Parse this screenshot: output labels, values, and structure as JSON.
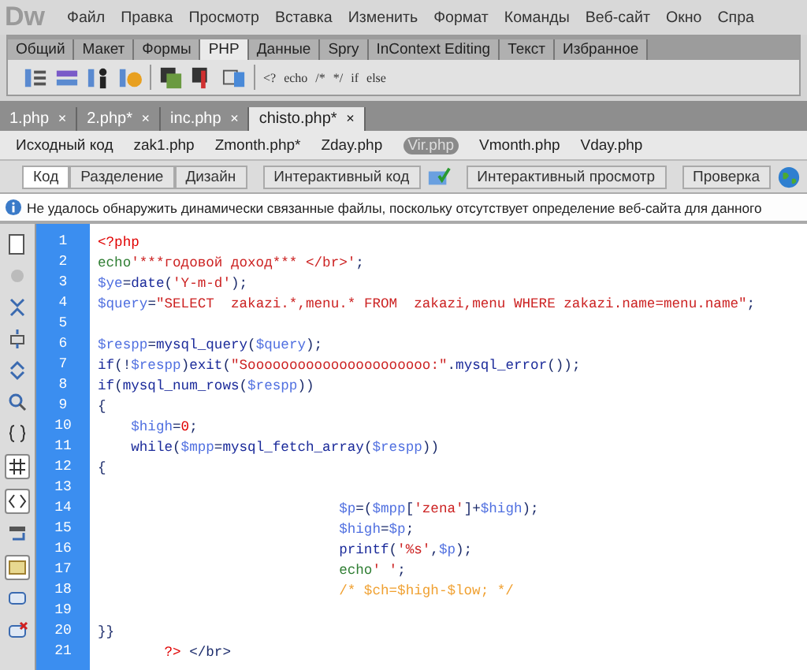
{
  "app_logo": "Dw",
  "menu": [
    "Файл",
    "Правка",
    "Просмотр",
    "Вставка",
    "Изменить",
    "Формат",
    "Команды",
    "Веб-сайт",
    "Окно",
    "Спра"
  ],
  "insert_tabs": [
    {
      "label": "Общий",
      "selected": false
    },
    {
      "label": "Макет",
      "selected": false
    },
    {
      "label": "Формы",
      "selected": false
    },
    {
      "label": "PHP",
      "selected": true
    },
    {
      "label": "Данные",
      "selected": false
    },
    {
      "label": "Spry",
      "selected": false
    },
    {
      "label": "InContext Editing",
      "selected": false
    },
    {
      "label": "Текст",
      "selected": false
    },
    {
      "label": "Избранное",
      "selected": false
    }
  ],
  "insert_text_buttons": [
    "<?",
    "echo",
    "/*",
    "*/",
    "if",
    "else"
  ],
  "doc_tabs": [
    {
      "label": "1.php",
      "selected": false
    },
    {
      "label": "2.php*",
      "selected": false
    },
    {
      "label": "inc.php",
      "selected": false
    },
    {
      "label": "chisto.php*",
      "selected": true
    }
  ],
  "close_glyph": "×",
  "related_files": [
    {
      "label": "Исходный код",
      "selected": false
    },
    {
      "label": "zak1.php",
      "selected": false
    },
    {
      "label": "Zmonth.php*",
      "selected": false
    },
    {
      "label": "Zday.php",
      "selected": false
    },
    {
      "label": "Vir.php",
      "selected": true
    },
    {
      "label": "Vmonth.php",
      "selected": false
    },
    {
      "label": "Vday.php",
      "selected": false
    }
  ],
  "view_modes": [
    {
      "label": "Код",
      "selected": true
    },
    {
      "label": "Разделение",
      "selected": false
    },
    {
      "label": "Дизайн",
      "selected": false
    }
  ],
  "live_code_button": "Интерактивный код",
  "live_view_button": "Интерактивный просмотр",
  "check_button": "Проверка",
  "info_message": "Не удалось обнаружить динамически связанные файлы, поскольку отсутствует определение веб-сайта для данного",
  "code_lines": [
    {
      "number": "1",
      "tokens": [
        {
          "kind": "tag",
          "text": "<?php"
        }
      ]
    },
    {
      "number": "2",
      "tokens": [
        {
          "kind": "keyword",
          "text": "echo"
        },
        {
          "kind": "string",
          "text": "'***годовой доход*** </br>'"
        },
        {
          "kind": "punct",
          "text": ";"
        }
      ]
    },
    {
      "number": "3",
      "tokens": [
        {
          "kind": "var",
          "text": "$ye"
        },
        {
          "kind": "punct",
          "text": "="
        },
        {
          "kind": "func",
          "text": "date"
        },
        {
          "kind": "punct",
          "text": "("
        },
        {
          "kind": "string",
          "text": "'Y-m-d'"
        },
        {
          "kind": "punct",
          "text": ");"
        }
      ]
    },
    {
      "number": "4",
      "tokens": [
        {
          "kind": "var",
          "text": "$query"
        },
        {
          "kind": "punct",
          "text": "="
        },
        {
          "kind": "string",
          "text": "\"SELECT  zakazi.*,menu.* FROM  zakazi,menu WHERE zakazi.name=menu.name\""
        },
        {
          "kind": "punct",
          "text": ";"
        }
      ]
    },
    {
      "number": "5"
    },
    {
      "number": "6",
      "tokens": [
        {
          "kind": "var",
          "text": "$respp"
        },
        {
          "kind": "punct",
          "text": "="
        },
        {
          "kind": "func",
          "text": "mysql_query"
        },
        {
          "kind": "punct",
          "text": "("
        },
        {
          "kind": "var",
          "text": "$query"
        },
        {
          "kind": "punct",
          "text": ");"
        }
      ]
    },
    {
      "number": "7",
      "tokens": [
        {
          "kind": "func",
          "text": "if"
        },
        {
          "kind": "punct",
          "text": "(!"
        },
        {
          "kind": "var",
          "text": "$respp"
        },
        {
          "kind": "punct",
          "text": ")"
        },
        {
          "kind": "func",
          "text": "exit"
        },
        {
          "kind": "punct",
          "text": "("
        },
        {
          "kind": "string",
          "text": "\"Soooooooooooooooooooooo:\""
        },
        {
          "kind": "punct",
          "text": "."
        },
        {
          "kind": "func",
          "text": "mysql_error"
        },
        {
          "kind": "punct",
          "text": "());"
        }
      ]
    },
    {
      "number": "8",
      "tokens": [
        {
          "kind": "func",
          "text": "if"
        },
        {
          "kind": "punct",
          "text": "("
        },
        {
          "kind": "func",
          "text": "mysql_num_rows"
        },
        {
          "kind": "punct",
          "text": "("
        },
        {
          "kind": "var",
          "text": "$respp"
        },
        {
          "kind": "punct",
          "text": "))"
        }
      ]
    },
    {
      "number": "9",
      "tokens": [
        {
          "kind": "punct",
          "text": "{"
        }
      ]
    },
    {
      "number": "10",
      "tokens": [
        {
          "kind": "var",
          "text": "    $high"
        },
        {
          "kind": "punct",
          "text": "="
        },
        {
          "kind": "number",
          "text": "0"
        },
        {
          "kind": "punct",
          "text": ";"
        }
      ]
    },
    {
      "number": "11",
      "tokens": [
        {
          "kind": "func",
          "text": "    while"
        },
        {
          "kind": "punct",
          "text": "("
        },
        {
          "kind": "var",
          "text": "$mpp"
        },
        {
          "kind": "punct",
          "text": "="
        },
        {
          "kind": "func",
          "text": "mysql_fetch_array"
        },
        {
          "kind": "punct",
          "text": "("
        },
        {
          "kind": "var",
          "text": "$respp"
        },
        {
          "kind": "punct",
          "text": "))"
        }
      ]
    },
    {
      "number": "12",
      "tokens": [
        {
          "kind": "punct",
          "text": "{"
        }
      ]
    },
    {
      "number": "13"
    },
    {
      "number": "14",
      "tokens": [
        {
          "kind": "var",
          "text": "                             $p"
        },
        {
          "kind": "punct",
          "text": "=("
        },
        {
          "kind": "var",
          "text": "$mpp"
        },
        {
          "kind": "punct",
          "text": "["
        },
        {
          "kind": "string",
          "text": "'zena'"
        },
        {
          "kind": "punct",
          "text": "]+"
        },
        {
          "kind": "var",
          "text": "$high"
        },
        {
          "kind": "punct",
          "text": ");"
        }
      ]
    },
    {
      "number": "15",
      "tokens": [
        {
          "kind": "var",
          "text": "                             $high"
        },
        {
          "kind": "punct",
          "text": "="
        },
        {
          "kind": "var",
          "text": "$p"
        },
        {
          "kind": "punct",
          "text": ";"
        }
      ]
    },
    {
      "number": "16",
      "tokens": [
        {
          "kind": "func",
          "text": "                             printf"
        },
        {
          "kind": "punct",
          "text": "("
        },
        {
          "kind": "string",
          "text": "'%s'"
        },
        {
          "kind": "punct",
          "text": ","
        },
        {
          "kind": "var",
          "text": "$p"
        },
        {
          "kind": "punct",
          "text": ");"
        }
      ]
    },
    {
      "number": "17",
      "tokens": [
        {
          "kind": "keyword",
          "text": "                             echo"
        },
        {
          "kind": "string",
          "text": "' '"
        },
        {
          "kind": "punct",
          "text": ";"
        }
      ]
    },
    {
      "number": "18",
      "tokens": [
        {
          "kind": "comment",
          "text": "                             /* $ch=$high-$low; */"
        }
      ]
    },
    {
      "number": "19"
    },
    {
      "number": "20",
      "tokens": [
        {
          "kind": "punct",
          "text": "}}"
        }
      ]
    },
    {
      "number": "21",
      "tokens": [
        {
          "kind": "tag",
          "text": "        ?>"
        },
        {
          "kind": "punct",
          "text": " </br>"
        }
      ]
    }
  ]
}
